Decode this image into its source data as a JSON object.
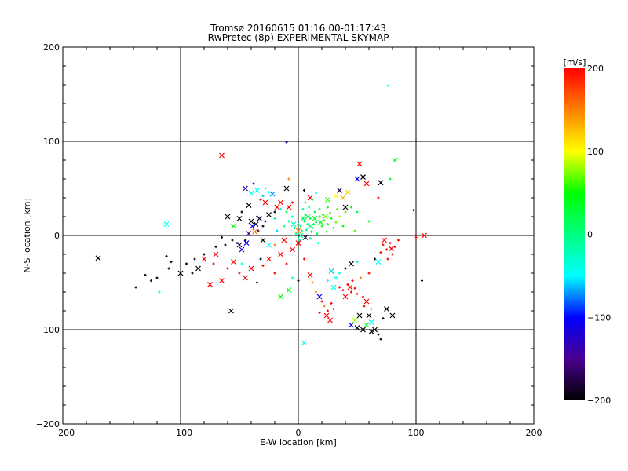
{
  "chart_data": {
    "type": "scatter",
    "title": "Tromsø 20160615 01:16:00-01:17:43",
    "subtitle": "RwPretec (8p) EXPERIMENTAL SKYMAP",
    "xlabel": "E-W location [km]",
    "ylabel": "N-S location [km]",
    "xlim": [
      -200,
      200
    ],
    "ylim": [
      -200,
      200
    ],
    "xticks": [
      -200,
      -100,
      0,
      100,
      200
    ],
    "yticks": [
      -200,
      -100,
      0,
      100,
      200
    ],
    "xtick_labels": [
      "−200",
      "−100",
      "0",
      "100",
      "200"
    ],
    "ytick_labels": [
      "−200",
      "−100",
      "0",
      "100",
      "200"
    ],
    "grid": true,
    "colorbar": {
      "label": "[m/s]",
      "range": [
        -200,
        200
      ],
      "ticks": [
        200,
        100,
        0,
        -100,
        -200
      ],
      "tick_labels": [
        "200",
        "100",
        "0",
        "−100",
        "−200"
      ],
      "stops": [
        [
          -200,
          "#000000"
        ],
        [
          -150,
          "#4a0090"
        ],
        [
          -100,
          "#0000ff"
        ],
        [
          -50,
          "#00ffff"
        ],
        [
          0,
          "#00ff80"
        ],
        [
          50,
          "#00ff00"
        ],
        [
          100,
          "#ffff00"
        ],
        [
          150,
          "#ff8000"
        ],
        [
          200,
          "#ff0000"
        ]
      ]
    },
    "point_format": [
      "x_km",
      "y_km",
      "velocity_m_s",
      "marker(1=cross,0=plus)"
    ],
    "points": [
      [
        2,
        10,
        10,
        0
      ],
      [
        5,
        15,
        20,
        0
      ],
      [
        8,
        12,
        30,
        0
      ],
      [
        10,
        18,
        40,
        0
      ],
      [
        12,
        8,
        25,
        0
      ],
      [
        15,
        14,
        35,
        0
      ],
      [
        18,
        20,
        45,
        0
      ],
      [
        20,
        10,
        50,
        0
      ],
      [
        22,
        16,
        60,
        0
      ],
      [
        25,
        12,
        55,
        0
      ],
      [
        28,
        18,
        50,
        0
      ],
      [
        30,
        8,
        40,
        0
      ],
      [
        6,
        22,
        15,
        0
      ],
      [
        3,
        5,
        5,
        0
      ],
      [
        0,
        12,
        0,
        0
      ],
      [
        -3,
        8,
        -5,
        0
      ],
      [
        14,
        25,
        30,
        0
      ],
      [
        18,
        28,
        20,
        0
      ],
      [
        9,
        30,
        10,
        0
      ],
      [
        4,
        28,
        -10,
        0
      ],
      [
        -5,
        20,
        -20,
        0
      ],
      [
        -8,
        15,
        -10,
        0
      ],
      [
        11,
        4,
        20,
        0
      ],
      [
        16,
        2,
        15,
        0
      ],
      [
        24,
        4,
        30,
        0
      ],
      [
        32,
        14,
        70,
        0
      ],
      [
        35,
        20,
        80,
        0
      ],
      [
        27,
        24,
        60,
        0
      ],
      [
        21,
        22,
        40,
        0
      ],
      [
        13,
        12,
        10,
        0
      ],
      [
        7,
        6,
        -5,
        0
      ],
      [
        -2,
        2,
        -15,
        0
      ],
      [
        1,
        -5,
        -20,
        0
      ],
      [
        10,
        -3,
        0,
        0
      ],
      [
        17,
        -8,
        -30,
        0
      ],
      [
        -10,
        25,
        10,
        0
      ],
      [
        -12,
        10,
        0,
        0
      ],
      [
        38,
        10,
        50,
        0
      ],
      [
        40,
        25,
        60,
        0
      ],
      [
        -15,
        28,
        -40,
        0
      ],
      [
        6,
        35,
        10,
        0
      ],
      [
        12,
        38,
        20,
        0
      ],
      [
        25,
        30,
        40,
        0
      ],
      [
        33,
        28,
        70,
        0
      ],
      [
        -20,
        18,
        0,
        0
      ],
      [
        45,
        30,
        50,
        0
      ],
      [
        50,
        25,
        20,
        0
      ],
      [
        60,
        15,
        40,
        0
      ],
      [
        48,
        5,
        60,
        0
      ],
      [
        -18,
        5,
        -60,
        0
      ],
      [
        4,
        18,
        15,
        1
      ],
      [
        8,
        20,
        25,
        1
      ],
      [
        14,
        18,
        35,
        1
      ],
      [
        19,
        14,
        45,
        1
      ],
      [
        10,
        10,
        5,
        1
      ],
      [
        -4,
        12,
        -25,
        1
      ],
      [
        23,
        20,
        70,
        1
      ],
      [
        2,
        0,
        -10,
        1
      ],
      [
        6,
        -2,
        -180,
        1
      ],
      [
        0,
        5,
        150,
        1
      ],
      [
        -40,
        15,
        -200,
        1
      ],
      [
        -36,
        12,
        -190,
        1
      ],
      [
        -33,
        18,
        -180,
        1
      ],
      [
        -38,
        8,
        -170,
        0
      ],
      [
        -34,
        5,
        -160,
        0
      ],
      [
        -30,
        10,
        -200,
        0
      ],
      [
        -42,
        2,
        -150,
        1
      ],
      [
        -35,
        20,
        -190,
        0
      ],
      [
        -28,
        15,
        -120,
        0
      ],
      [
        -45,
        -5,
        -200,
        0
      ],
      [
        -50,
        -10,
        -180,
        1
      ],
      [
        -48,
        -15,
        -130,
        1
      ],
      [
        -52,
        -8,
        -140,
        0
      ],
      [
        -25,
        22,
        -200,
        1
      ],
      [
        -20,
        25,
        -190,
        0
      ],
      [
        -60,
        20,
        -200,
        1
      ],
      [
        -39,
        10,
        -100,
        1
      ],
      [
        -37,
        4,
        150,
        1
      ],
      [
        -44,
        -8,
        -110,
        1
      ],
      [
        -30,
        -5,
        -200,
        1
      ],
      [
        -56,
        -5,
        -200,
        0
      ],
      [
        -62,
        -10,
        -200,
        0
      ],
      [
        -65,
        -2,
        -200,
        0
      ],
      [
        -70,
        -12,
        -190,
        0
      ],
      [
        -80,
        -20,
        -200,
        0
      ],
      [
        -88,
        -25,
        -200,
        0
      ],
      [
        -95,
        -30,
        -200,
        0
      ],
      [
        -100,
        -40,
        -200,
        1
      ],
      [
        -108,
        -28,
        -200,
        0
      ],
      [
        -110,
        -35,
        -200,
        0
      ],
      [
        -112,
        -22,
        -200,
        0
      ],
      [
        -120,
        -45,
        -200,
        0
      ],
      [
        -125,
        -48,
        -200,
        0
      ],
      [
        -130,
        -42,
        -200,
        0
      ],
      [
        -138,
        -55,
        -200,
        0
      ],
      [
        -118,
        -60,
        -30,
        0
      ],
      [
        -170,
        -24,
        -200,
        1
      ],
      [
        -112,
        12,
        -40,
        1
      ],
      [
        -40,
        45,
        -40,
        1
      ],
      [
        -35,
        48,
        -50,
        1
      ],
      [
        -30,
        42,
        -60,
        0
      ],
      [
        -25,
        46,
        -40,
        0
      ],
      [
        -28,
        50,
        -45,
        0
      ],
      [
        -22,
        44,
        -70,
        1
      ],
      [
        -45,
        50,
        -130,
        1
      ],
      [
        -38,
        55,
        -120,
        0
      ],
      [
        -10,
        50,
        -200,
        1
      ],
      [
        -8,
        60,
        150,
        0
      ],
      [
        5,
        48,
        -200,
        0
      ],
      [
        10,
        40,
        200,
        1
      ],
      [
        35,
        48,
        -180,
        1
      ],
      [
        38,
        40,
        130,
        1
      ],
      [
        40,
        30,
        -200,
        1
      ],
      [
        42,
        46,
        120,
        1
      ],
      [
        50,
        60,
        -100,
        1
      ],
      [
        55,
        62,
        -200,
        1
      ],
      [
        58,
        55,
        200,
        1
      ],
      [
        52,
        76,
        200,
        1
      ],
      [
        70,
        56,
        -200,
        1
      ],
      [
        68,
        40,
        200,
        0
      ],
      [
        82,
        80,
        50,
        1
      ],
      [
        78,
        60,
        40,
        0
      ],
      [
        -65,
        85,
        200,
        1
      ],
      [
        -10,
        99,
        -130,
        0
      ],
      [
        76,
        159,
        -30,
        0
      ],
      [
        98,
        27,
        -200,
        0
      ],
      [
        100,
        -2,
        200,
        0
      ],
      [
        107,
        0,
        200,
        1
      ],
      [
        105,
        -48,
        -200,
        0
      ],
      [
        72,
        -10,
        200,
        0
      ],
      [
        75,
        -15,
        200,
        0
      ],
      [
        78,
        -8,
        200,
        0
      ],
      [
        80,
        -20,
        200,
        0
      ],
      [
        82,
        -12,
        200,
        0
      ],
      [
        76,
        -25,
        200,
        0
      ],
      [
        70,
        -18,
        200,
        0
      ],
      [
        85,
        -5,
        200,
        0
      ],
      [
        73,
        -5,
        200,
        1
      ],
      [
        79,
        -14,
        200,
        1
      ],
      [
        68,
        -28,
        -50,
        1
      ],
      [
        65,
        -25,
        -200,
        0
      ],
      [
        35,
        -55,
        200,
        0
      ],
      [
        38,
        -58,
        200,
        0
      ],
      [
        42,
        -52,
        200,
        0
      ],
      [
        45,
        -60,
        200,
        0
      ],
      [
        48,
        -56,
        200,
        0
      ],
      [
        50,
        -62,
        180,
        0
      ],
      [
        52,
        -58,
        100,
        0
      ],
      [
        55,
        -65,
        200,
        0
      ],
      [
        40,
        -65,
        200,
        1
      ],
      [
        44,
        -55,
        200,
        1
      ],
      [
        58,
        -70,
        200,
        1
      ],
      [
        46,
        -48,
        200,
        0
      ],
      [
        53,
        -45,
        150,
        0
      ],
      [
        60,
        -40,
        200,
        0
      ],
      [
        56,
        -75,
        200,
        0
      ],
      [
        62,
        -78,
        150,
        0
      ],
      [
        20,
        -70,
        200,
        0
      ],
      [
        22,
        -75,
        150,
        0
      ],
      [
        25,
        -80,
        200,
        0
      ],
      [
        28,
        -72,
        200,
        0
      ],
      [
        18,
        -82,
        200,
        0
      ],
      [
        24,
        -85,
        200,
        1
      ],
      [
        30,
        -78,
        200,
        0
      ],
      [
        27,
        -90,
        200,
        1
      ],
      [
        15,
        -60,
        150,
        0
      ],
      [
        18,
        -65,
        -100,
        1
      ],
      [
        32,
        -45,
        -50,
        1
      ],
      [
        35,
        -40,
        -40,
        0
      ],
      [
        28,
        -38,
        -60,
        1
      ],
      [
        40,
        -35,
        -200,
        0
      ],
      [
        45,
        -30,
        -200,
        1
      ],
      [
        50,
        -28,
        -40,
        0
      ],
      [
        45,
        -95,
        -100,
        1
      ],
      [
        50,
        -98,
        -200,
        1
      ],
      [
        55,
        -100,
        -200,
        1
      ],
      [
        62,
        -102,
        -200,
        1
      ],
      [
        65,
        -100,
        -200,
        1
      ],
      [
        68,
        -105,
        -200,
        0
      ],
      [
        70,
        -110,
        -200,
        0
      ],
      [
        72,
        -88,
        -200,
        0
      ],
      [
        75,
        -78,
        -200,
        1
      ],
      [
        80,
        -85,
        -200,
        1
      ],
      [
        52,
        -85,
        -200,
        1
      ],
      [
        60,
        -85,
        -200,
        1
      ],
      [
        58,
        -95,
        30,
        1
      ],
      [
        48,
        -90,
        80,
        1
      ],
      [
        62,
        -92,
        -50,
        1
      ],
      [
        5,
        -114,
        -50,
        1
      ],
      [
        -80,
        -25,
        200,
        1
      ],
      [
        -72,
        -30,
        200,
        0
      ],
      [
        -70,
        -20,
        200,
        1
      ],
      [
        -60,
        -35,
        200,
        0
      ],
      [
        -55,
        -28,
        200,
        1
      ],
      [
        -50,
        -40,
        200,
        0
      ],
      [
        -45,
        -45,
        200,
        1
      ],
      [
        -65,
        -48,
        200,
        1
      ],
      [
        -75,
        -52,
        200,
        1
      ],
      [
        -40,
        -35,
        200,
        1
      ],
      [
        -30,
        -32,
        200,
        0
      ],
      [
        -25,
        -25,
        200,
        1
      ],
      [
        -20,
        -40,
        200,
        0
      ],
      [
        -15,
        -20,
        200,
        1
      ],
      [
        -10,
        -30,
        200,
        0
      ],
      [
        -5,
        -15,
        200,
        1
      ],
      [
        -85,
        -35,
        -200,
        1
      ],
      [
        -90,
        -40,
        -200,
        0
      ],
      [
        -57,
        -80,
        -200,
        1
      ],
      [
        -32,
        -25,
        -200,
        0
      ],
      [
        -20,
        -10,
        150,
        0
      ],
      [
        -12,
        -5,
        200,
        1
      ],
      [
        0,
        -8,
        200,
        1
      ],
      [
        5,
        -25,
        200,
        0
      ],
      [
        -5,
        -45,
        -30,
        0
      ],
      [
        -8,
        -58,
        40,
        1
      ],
      [
        0,
        -48,
        -200,
        0
      ],
      [
        10,
        -42,
        200,
        1
      ],
      [
        12,
        -50,
        150,
        0
      ],
      [
        25,
        -48,
        -50,
        0
      ],
      [
        30,
        -55,
        -40,
        1
      ],
      [
        -48,
        -30,
        -40,
        0
      ],
      [
        -35,
        -50,
        -200,
        0
      ],
      [
        -15,
        -65,
        50,
        1
      ],
      [
        -25,
        -10,
        -50,
        1
      ],
      [
        -55,
        10,
        50,
        1
      ],
      [
        -50,
        18,
        -200,
        1
      ],
      [
        -48,
        25,
        -200,
        0
      ],
      [
        -42,
        32,
        -200,
        1
      ],
      [
        -15,
        35,
        200,
        1
      ],
      [
        -28,
        35,
        200,
        1
      ],
      [
        -32,
        38,
        200,
        0
      ],
      [
        -18,
        30,
        200,
        1
      ],
      [
        -8,
        30,
        200,
        1
      ],
      [
        -5,
        35,
        200,
        0
      ],
      [
        15,
        45,
        -50,
        0
      ],
      [
        25,
        38,
        60,
        1
      ],
      [
        32,
        42,
        100,
        1
      ]
    ]
  }
}
